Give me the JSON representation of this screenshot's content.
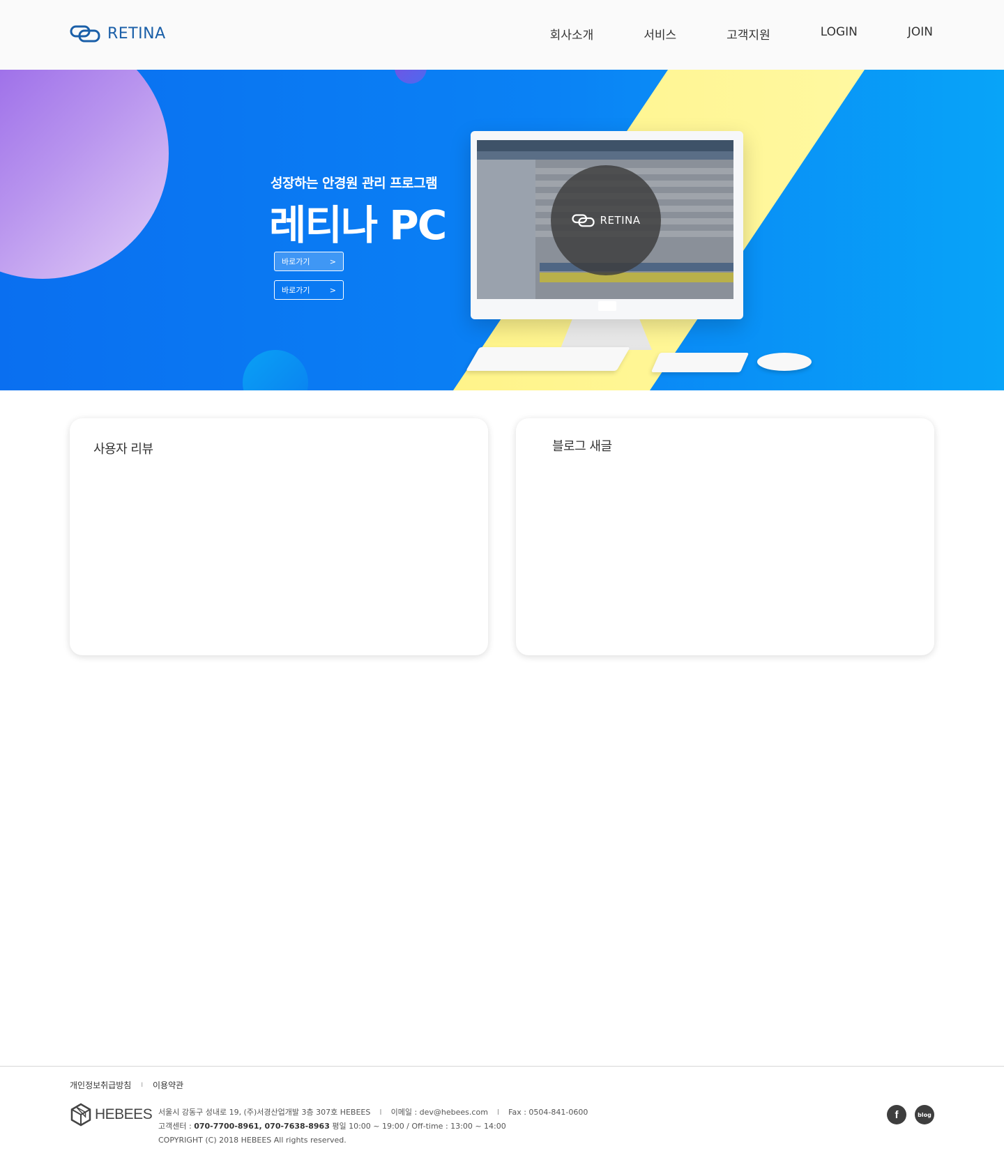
{
  "header": {
    "logo_text": "RETINA",
    "nav": [
      "회사소개",
      "서비스",
      "고객지원",
      "LOGIN",
      "JOIN"
    ]
  },
  "hero": {
    "subtitle": "성장하는 안경원 관리 프로그램",
    "title": "레티나 PC",
    "buttons": [
      {
        "label": "바로가기",
        "arrow": ">"
      },
      {
        "label": "바로가기",
        "arrow": ">"
      }
    ],
    "screen_logo_text": "RETINA"
  },
  "cards": {
    "reviews_title": "사용자 리뷰",
    "blog_title": "블로그 새글"
  },
  "footer": {
    "links": [
      "개인정보취급방침",
      "이용약관"
    ],
    "link_separator": "I",
    "logo_text": "HEBEES",
    "address": "서울시 강동구 성내로 19, (주)서경산업개발 3층 307호 HEBEES",
    "email": "이메일 : dev@hebees.com",
    "fax": "Fax : 0504-841-0600",
    "cs_label": "고객센터 : ",
    "cs_phones": "070-7700-8961, 070-7638-8963",
    "cs_hours": " 평일 10:00 ~ 19:00 / Off-time : 13:00 ~ 14:00",
    "copyright": "COPYRIGHT (C) 2018 HEBEES All rights reserved.",
    "social": {
      "facebook": "f",
      "blog": "blog"
    }
  },
  "colors": {
    "brand_blue": "#1a5fa8",
    "hero_blue": "#0a78f2",
    "hero_yellow": "#fff48a",
    "hero_purple": "#9a6ce8"
  }
}
